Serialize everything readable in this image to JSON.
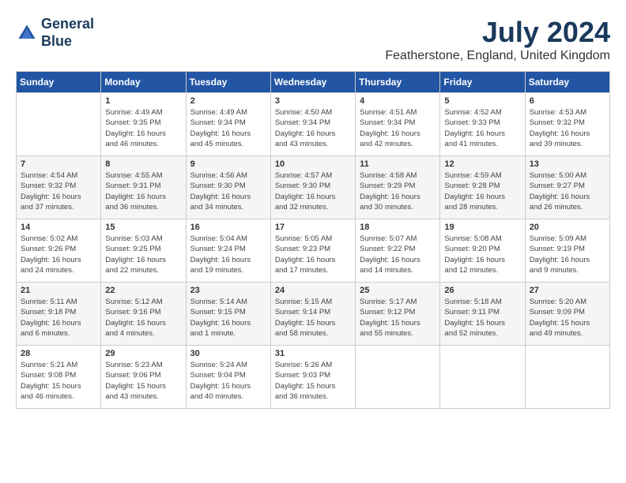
{
  "logo": {
    "line1": "General",
    "line2": "Blue"
  },
  "header": {
    "month_year": "July 2024",
    "location": "Featherstone, England, United Kingdom"
  },
  "days_of_week": [
    "Sunday",
    "Monday",
    "Tuesday",
    "Wednesday",
    "Thursday",
    "Friday",
    "Saturday"
  ],
  "weeks": [
    [
      {
        "num": "",
        "info": ""
      },
      {
        "num": "1",
        "info": "Sunrise: 4:49 AM\nSunset: 9:35 PM\nDaylight: 16 hours\nand 46 minutes."
      },
      {
        "num": "2",
        "info": "Sunrise: 4:49 AM\nSunset: 9:34 PM\nDaylight: 16 hours\nand 45 minutes."
      },
      {
        "num": "3",
        "info": "Sunrise: 4:50 AM\nSunset: 9:34 PM\nDaylight: 16 hours\nand 43 minutes."
      },
      {
        "num": "4",
        "info": "Sunrise: 4:51 AM\nSunset: 9:34 PM\nDaylight: 16 hours\nand 42 minutes."
      },
      {
        "num": "5",
        "info": "Sunrise: 4:52 AM\nSunset: 9:33 PM\nDaylight: 16 hours\nand 41 minutes."
      },
      {
        "num": "6",
        "info": "Sunrise: 4:53 AM\nSunset: 9:32 PM\nDaylight: 16 hours\nand 39 minutes."
      }
    ],
    [
      {
        "num": "7",
        "info": "Sunrise: 4:54 AM\nSunset: 9:32 PM\nDaylight: 16 hours\nand 37 minutes."
      },
      {
        "num": "8",
        "info": "Sunrise: 4:55 AM\nSunset: 9:31 PM\nDaylight: 16 hours\nand 36 minutes."
      },
      {
        "num": "9",
        "info": "Sunrise: 4:56 AM\nSunset: 9:30 PM\nDaylight: 16 hours\nand 34 minutes."
      },
      {
        "num": "10",
        "info": "Sunrise: 4:57 AM\nSunset: 9:30 PM\nDaylight: 16 hours\nand 32 minutes."
      },
      {
        "num": "11",
        "info": "Sunrise: 4:58 AM\nSunset: 9:29 PM\nDaylight: 16 hours\nand 30 minutes."
      },
      {
        "num": "12",
        "info": "Sunrise: 4:59 AM\nSunset: 9:28 PM\nDaylight: 16 hours\nand 28 minutes."
      },
      {
        "num": "13",
        "info": "Sunrise: 5:00 AM\nSunset: 9:27 PM\nDaylight: 16 hours\nand 26 minutes."
      }
    ],
    [
      {
        "num": "14",
        "info": "Sunrise: 5:02 AM\nSunset: 9:26 PM\nDaylight: 16 hours\nand 24 minutes."
      },
      {
        "num": "15",
        "info": "Sunrise: 5:03 AM\nSunset: 9:25 PM\nDaylight: 16 hours\nand 22 minutes."
      },
      {
        "num": "16",
        "info": "Sunrise: 5:04 AM\nSunset: 9:24 PM\nDaylight: 16 hours\nand 19 minutes."
      },
      {
        "num": "17",
        "info": "Sunrise: 5:05 AM\nSunset: 9:23 PM\nDaylight: 16 hours\nand 17 minutes."
      },
      {
        "num": "18",
        "info": "Sunrise: 5:07 AM\nSunset: 9:22 PM\nDaylight: 16 hours\nand 14 minutes."
      },
      {
        "num": "19",
        "info": "Sunrise: 5:08 AM\nSunset: 9:20 PM\nDaylight: 16 hours\nand 12 minutes."
      },
      {
        "num": "20",
        "info": "Sunrise: 5:09 AM\nSunset: 9:19 PM\nDaylight: 16 hours\nand 9 minutes."
      }
    ],
    [
      {
        "num": "21",
        "info": "Sunrise: 5:11 AM\nSunset: 9:18 PM\nDaylight: 16 hours\nand 6 minutes."
      },
      {
        "num": "22",
        "info": "Sunrise: 5:12 AM\nSunset: 9:16 PM\nDaylight: 16 hours\nand 4 minutes."
      },
      {
        "num": "23",
        "info": "Sunrise: 5:14 AM\nSunset: 9:15 PM\nDaylight: 16 hours\nand 1 minute."
      },
      {
        "num": "24",
        "info": "Sunrise: 5:15 AM\nSunset: 9:14 PM\nDaylight: 15 hours\nand 58 minutes."
      },
      {
        "num": "25",
        "info": "Sunrise: 5:17 AM\nSunset: 9:12 PM\nDaylight: 15 hours\nand 55 minutes."
      },
      {
        "num": "26",
        "info": "Sunrise: 5:18 AM\nSunset: 9:11 PM\nDaylight: 15 hours\nand 52 minutes."
      },
      {
        "num": "27",
        "info": "Sunrise: 5:20 AM\nSunset: 9:09 PM\nDaylight: 15 hours\nand 49 minutes."
      }
    ],
    [
      {
        "num": "28",
        "info": "Sunrise: 5:21 AM\nSunset: 9:08 PM\nDaylight: 15 hours\nand 46 minutes."
      },
      {
        "num": "29",
        "info": "Sunrise: 5:23 AM\nSunset: 9:06 PM\nDaylight: 15 hours\nand 43 minutes."
      },
      {
        "num": "30",
        "info": "Sunrise: 5:24 AM\nSunset: 9:04 PM\nDaylight: 15 hours\nand 40 minutes."
      },
      {
        "num": "31",
        "info": "Sunrise: 5:26 AM\nSunset: 9:03 PM\nDaylight: 15 hours\nand 36 minutes."
      },
      {
        "num": "",
        "info": ""
      },
      {
        "num": "",
        "info": ""
      },
      {
        "num": "",
        "info": ""
      }
    ]
  ]
}
